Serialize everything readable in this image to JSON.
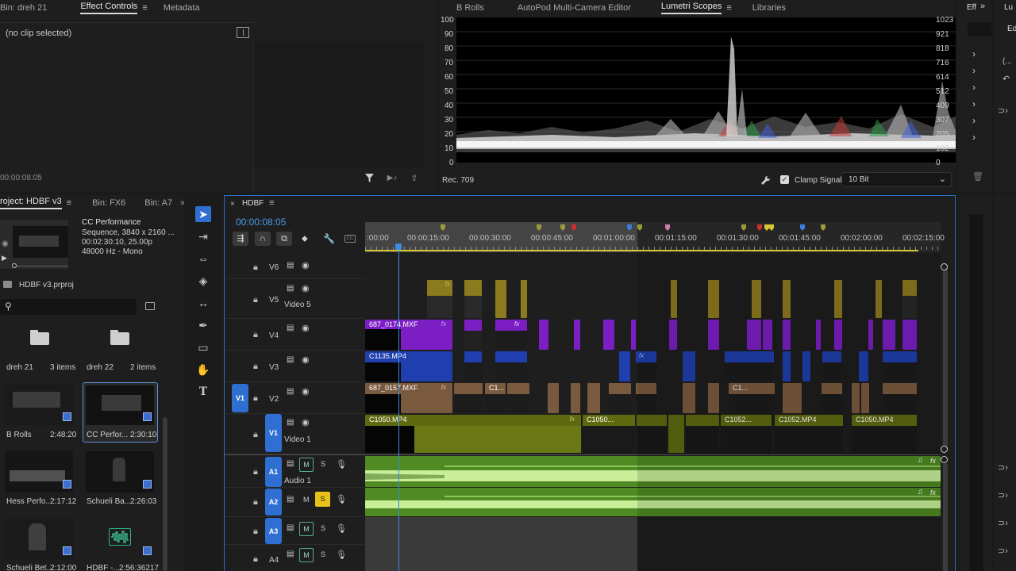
{
  "effect_controls": {
    "tabs": [
      {
        "label": "Bin: dreh 21",
        "active": false
      },
      {
        "label": "Effect Controls",
        "active": true
      },
      {
        "label": "Metadata",
        "active": false
      }
    ],
    "no_clip": "(no clip selected)",
    "timecode": "00:00:08:05"
  },
  "scopes": {
    "tabs": [
      {
        "label": "B Rolls",
        "active": false
      },
      {
        "label": "AutoPod Multi-Camera Editor",
        "active": false
      },
      {
        "label": "Lumetri Scopes",
        "active": true
      },
      {
        "label": "Libraries",
        "active": false
      }
    ],
    "left_scale": [
      "100",
      "90",
      "80",
      "70",
      "60",
      "50",
      "40",
      "30",
      "20",
      "10",
      "0"
    ],
    "right_scale": [
      "1023",
      "921",
      "818",
      "716",
      "614",
      "512",
      "409",
      "307",
      "205",
      "102",
      "0"
    ],
    "colorspace": "Rec. 709",
    "clamp_label": "Clamp Signal",
    "bit_depth": "10 Bit"
  },
  "effects_panel": {
    "tab": "Eff",
    "tab2": "Lu",
    "tab2_sub": "Ed",
    "tab2_sub2": "(..."
  },
  "project": {
    "tabs": [
      {
        "label": "roject: HDBF v3",
        "active": true
      },
      {
        "label": "Bin: FX6",
        "active": false
      },
      {
        "label": "Bin: A7",
        "active": false
      }
    ],
    "preview": {
      "name": "CC Performance",
      "line1": "Sequence, 3840 x 2160 ...",
      "line2": "00:02:30:10, 25.00p",
      "line3": "48000 Hz - Mono"
    },
    "file": "HDBF v3.prproj",
    "search_placeholder": "",
    "folders": [
      {
        "name": "dreh 21",
        "count": "3 items"
      },
      {
        "name": "dreh 22",
        "count": "2 items"
      }
    ],
    "items": [
      {
        "name": "B Rolls",
        "duration": "2:48:20"
      },
      {
        "name": "CC Perfor...",
        "duration": "2:30:10"
      },
      {
        "name": "Hess Perfo...",
        "duration": "2:17:12"
      },
      {
        "name": "Schueli Ba...",
        "duration": "2:26:03"
      },
      {
        "name": "Schueli Bet...",
        "duration": "2:12:00"
      },
      {
        "name": "HDBF -...",
        "duration": "2:56:36217"
      }
    ]
  },
  "timeline": {
    "sequence": "HDBF",
    "timecode": "00:00:08:05",
    "ruler": [
      ":00:00",
      "00:00:15:00",
      "00:00:30:00",
      "00:00:45:00",
      "00:01:00:00",
      "00:01:15:00",
      "00:01:30:00",
      "00:01:45:00",
      "00:02:00:00",
      "00:02:15:00"
    ],
    "tracks": {
      "v6": "V6",
      "v5": "V5",
      "v5_name": "Video 5",
      "v4": "V4",
      "v3": "V3",
      "v2": "V2",
      "v2_src": "V1",
      "v1": "V1",
      "v1_name": "Video 1",
      "a1": "A1",
      "a1_name": "Audio 1",
      "a2": "A2",
      "a3": "A3",
      "a4": "A4"
    },
    "clip_labels": {
      "v4": "687_0174.MXF",
      "v3": "C1135.MP4",
      "v2": "687_0157.MXF",
      "v2b": "C1...",
      "v2c": "C1...",
      "v1": "C1050.MP4",
      "v1b": "C1050...",
      "v1c": "C1052...",
      "v1d": "C1052.MP4",
      "v1e": "C1050.MP4"
    },
    "mute_label": "M",
    "solo_label": "S",
    "fx_label": "fx",
    "colors": {
      "v5": "#8c7a1e",
      "v4": "#7b1fc4",
      "v3": "#1f3fae",
      "v2": "#7a5a3f",
      "v1": "#5f6a10",
      "audio": "#4f8a22"
    }
  }
}
